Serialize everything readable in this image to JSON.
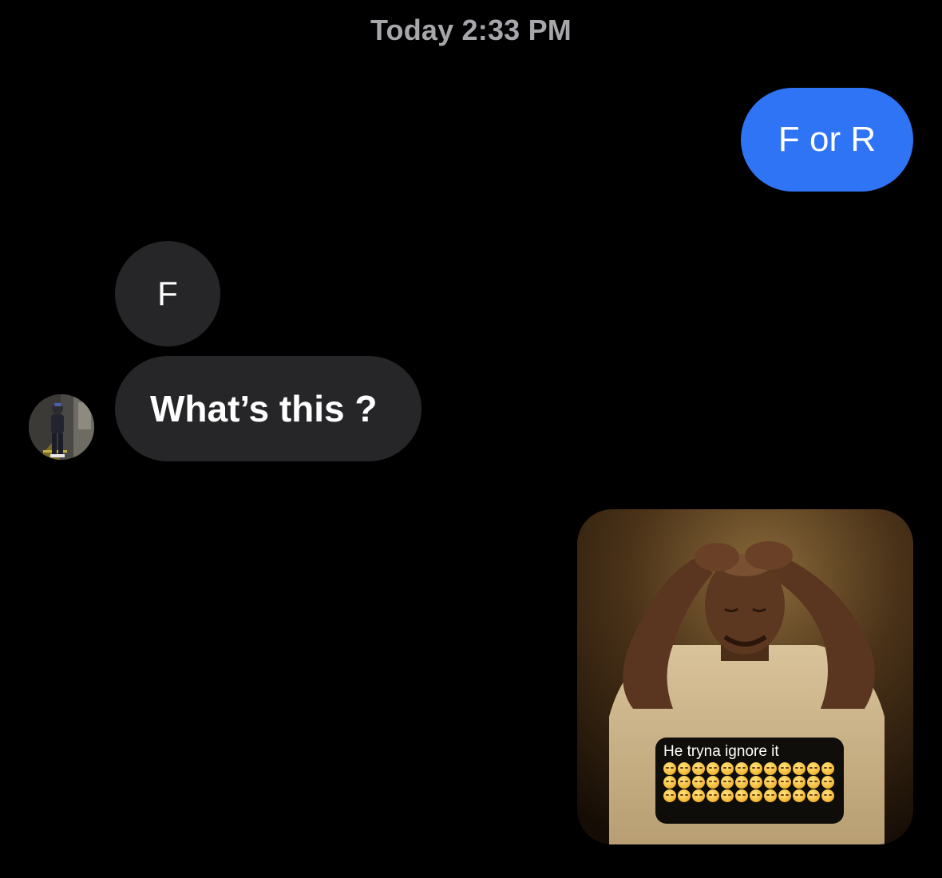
{
  "thread": {
    "timestamp": "Today 2:33 PM"
  },
  "messages": [
    {
      "direction": "outgoing",
      "type": "text",
      "text": "F or R"
    },
    {
      "direction": "incoming",
      "type": "text",
      "text": "F"
    },
    {
      "direction": "incoming",
      "type": "text",
      "text": "What’s this ?"
    },
    {
      "direction": "outgoing",
      "type": "image",
      "caption": "He tryna ignore it"
    }
  ],
  "colors": {
    "background": "#000000",
    "outgoing_bubble": "#2f74f5",
    "incoming_bubble": "#262628",
    "timestamp_text": "#a6a6ab"
  },
  "icons": {
    "avatar": "contact-avatar"
  }
}
